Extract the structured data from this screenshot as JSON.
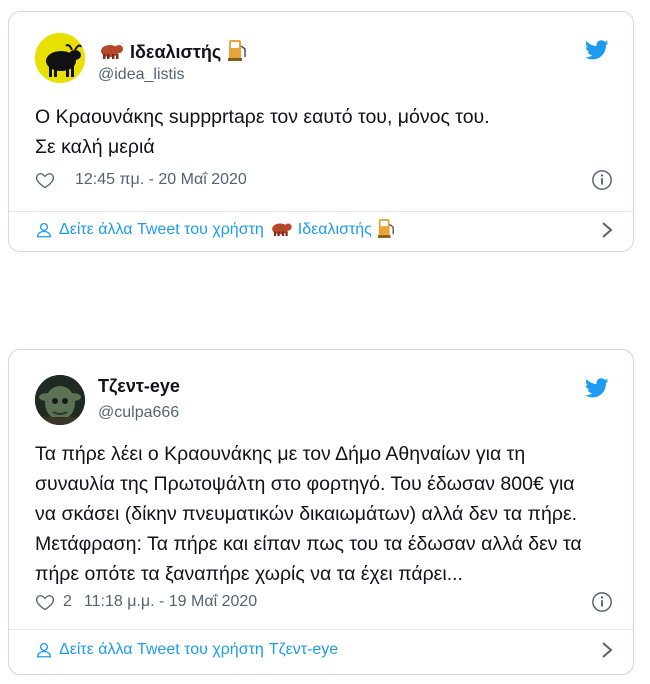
{
  "tweets": [
    {
      "display_name": "Ιδεαλιστής",
      "handle": "@idea_listis",
      "text_lines": [
        "Ο Κραουνάκης suppprtaρε τον εαυτό του, μόνος του.",
        "Σε καλή μεριά"
      ],
      "like_count": "",
      "timestamp": "12:45 πμ. - 20 Μαΐ 2020",
      "footer_prefix": "Δείτε άλλα Tweet του χρήστη",
      "footer_name": "Ιδεαλιστής",
      "name_emojis": [
        "ox-emoji",
        "fuel-pump-emoji"
      ]
    },
    {
      "display_name": "Τζεντ-eye",
      "handle": "@culpa666",
      "text_lines": [
        "Τα πήρε λέει ο Κραουνάκης με τον Δήμο Αθηναίων για τη",
        "συναυλία της Πρωτοψάλτη στο φορτηγό. Του έδωσαν 800€ για",
        "να σκάσει (δίκην πνευματικών δικαιωμάτων) αλλά δεν τα πήρε.",
        "Μετάφραση: Τα πήρε και είπαν πως του τα έδωσαν αλλά δεν τα",
        "πήρε οπότε τα ξαναπήρε χωρίς να τα έχει πάρει..."
      ],
      "like_count": "2",
      "timestamp": "11:18 μ.μ. - 19 Μαΐ 2020",
      "footer_prefix": "Δείτε άλλα Tweet του χρήστη",
      "footer_name": "Τζεντ-eye"
    }
  ],
  "colors": {
    "twitter_blue": "#1d9bf0",
    "muted": "#536471",
    "border": "#cfd9de"
  }
}
